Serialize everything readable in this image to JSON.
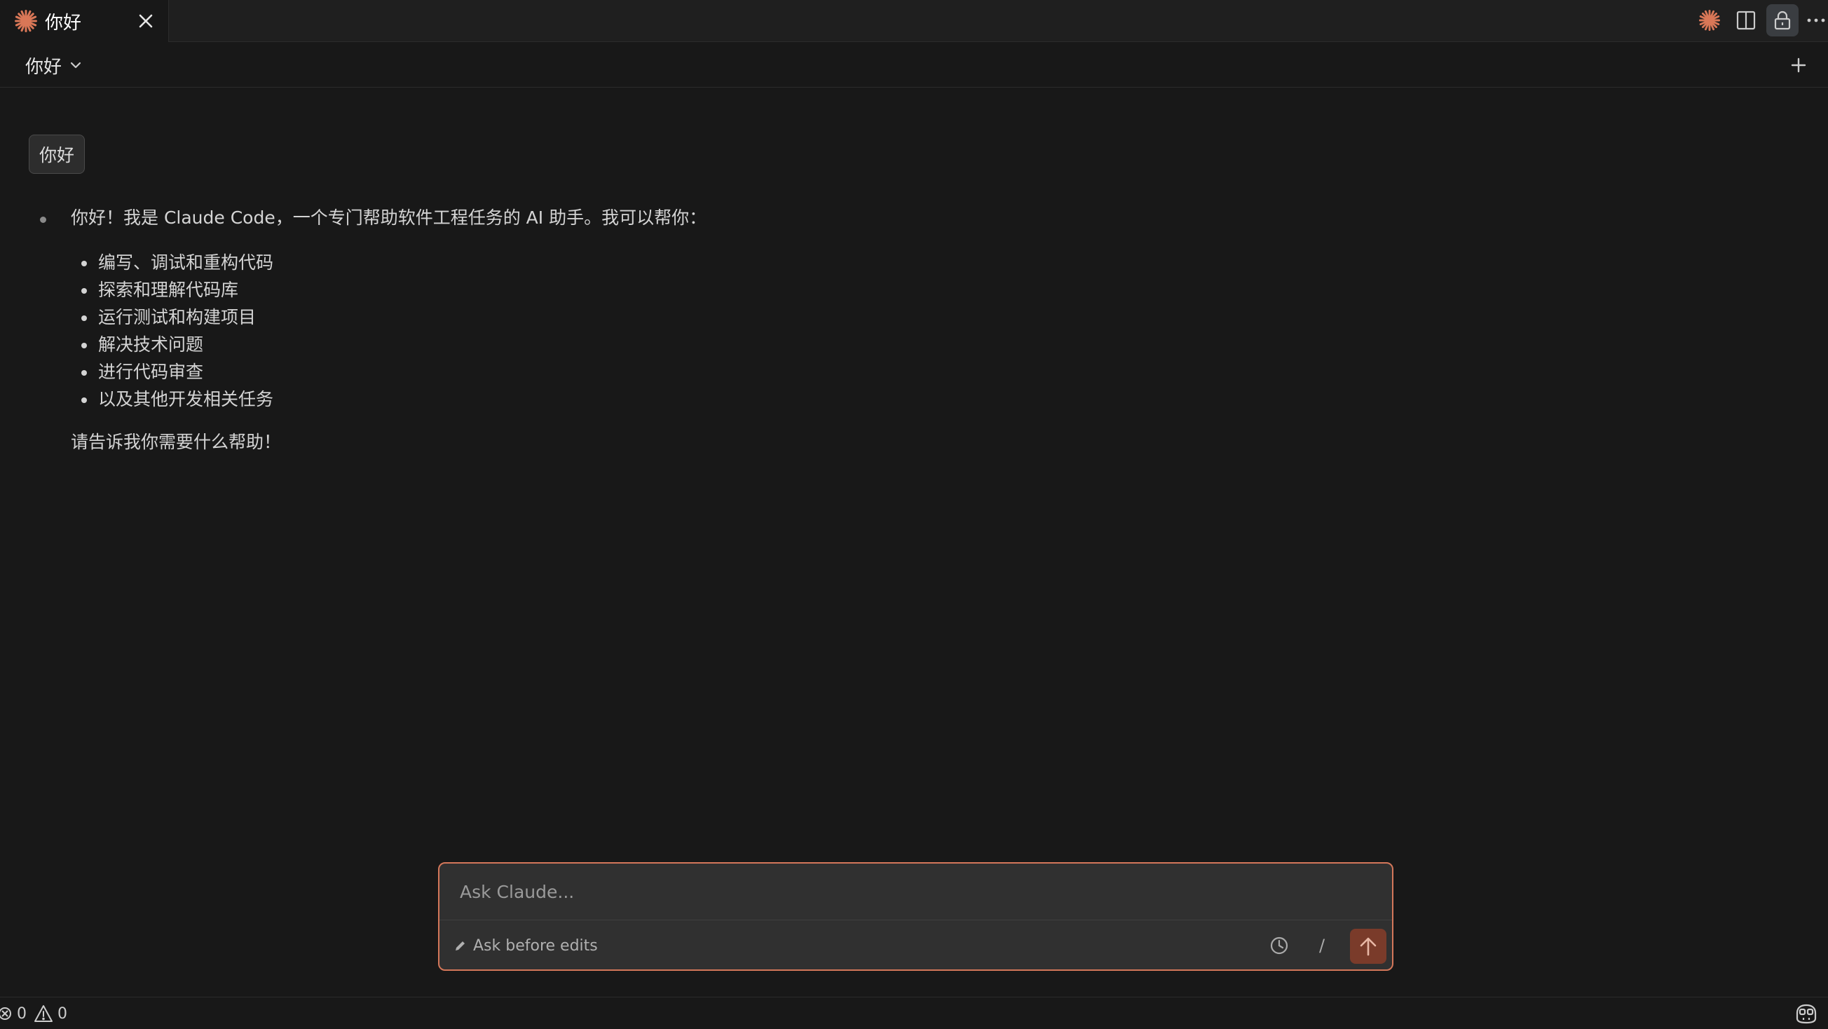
{
  "tab": {
    "label": "你好"
  },
  "header": {
    "title": "你好"
  },
  "conversation": {
    "user_message": "你好",
    "assistant": {
      "intro": "你好！我是 Claude Code，一个专门帮助软件工程任务的 AI 助手。我可以帮你：",
      "items": [
        "编写、调试和重构代码",
        "探索和理解代码库",
        "运行测试和构建项目",
        "解决技术问题",
        "进行代码审查",
        "以及其他开发相关任务"
      ],
      "outro": "请告诉我你需要什么帮助！"
    }
  },
  "composer": {
    "placeholder": "Ask Claude...",
    "value": "",
    "mode_label": "Ask before edits",
    "slash_label": "/"
  },
  "statusbar": {
    "errors": "0",
    "warnings": "0"
  },
  "colors": {
    "accent": "#d97757",
    "send_bg": "#7a3b2a",
    "border_accent": "#d4775a"
  },
  "icons": {
    "tab": "claude-spark-icon",
    "close": "close-icon",
    "split": "split-editor-icon",
    "lock": "lock-icon",
    "more": "more-icon",
    "chevron": "chevron-down-icon",
    "new": "plus-icon",
    "mode": "pencil-icon",
    "history": "history-icon",
    "send": "arrow-up-icon",
    "errors": "error-icon",
    "warnings": "warning-icon",
    "copilot": "copilot-icon"
  }
}
